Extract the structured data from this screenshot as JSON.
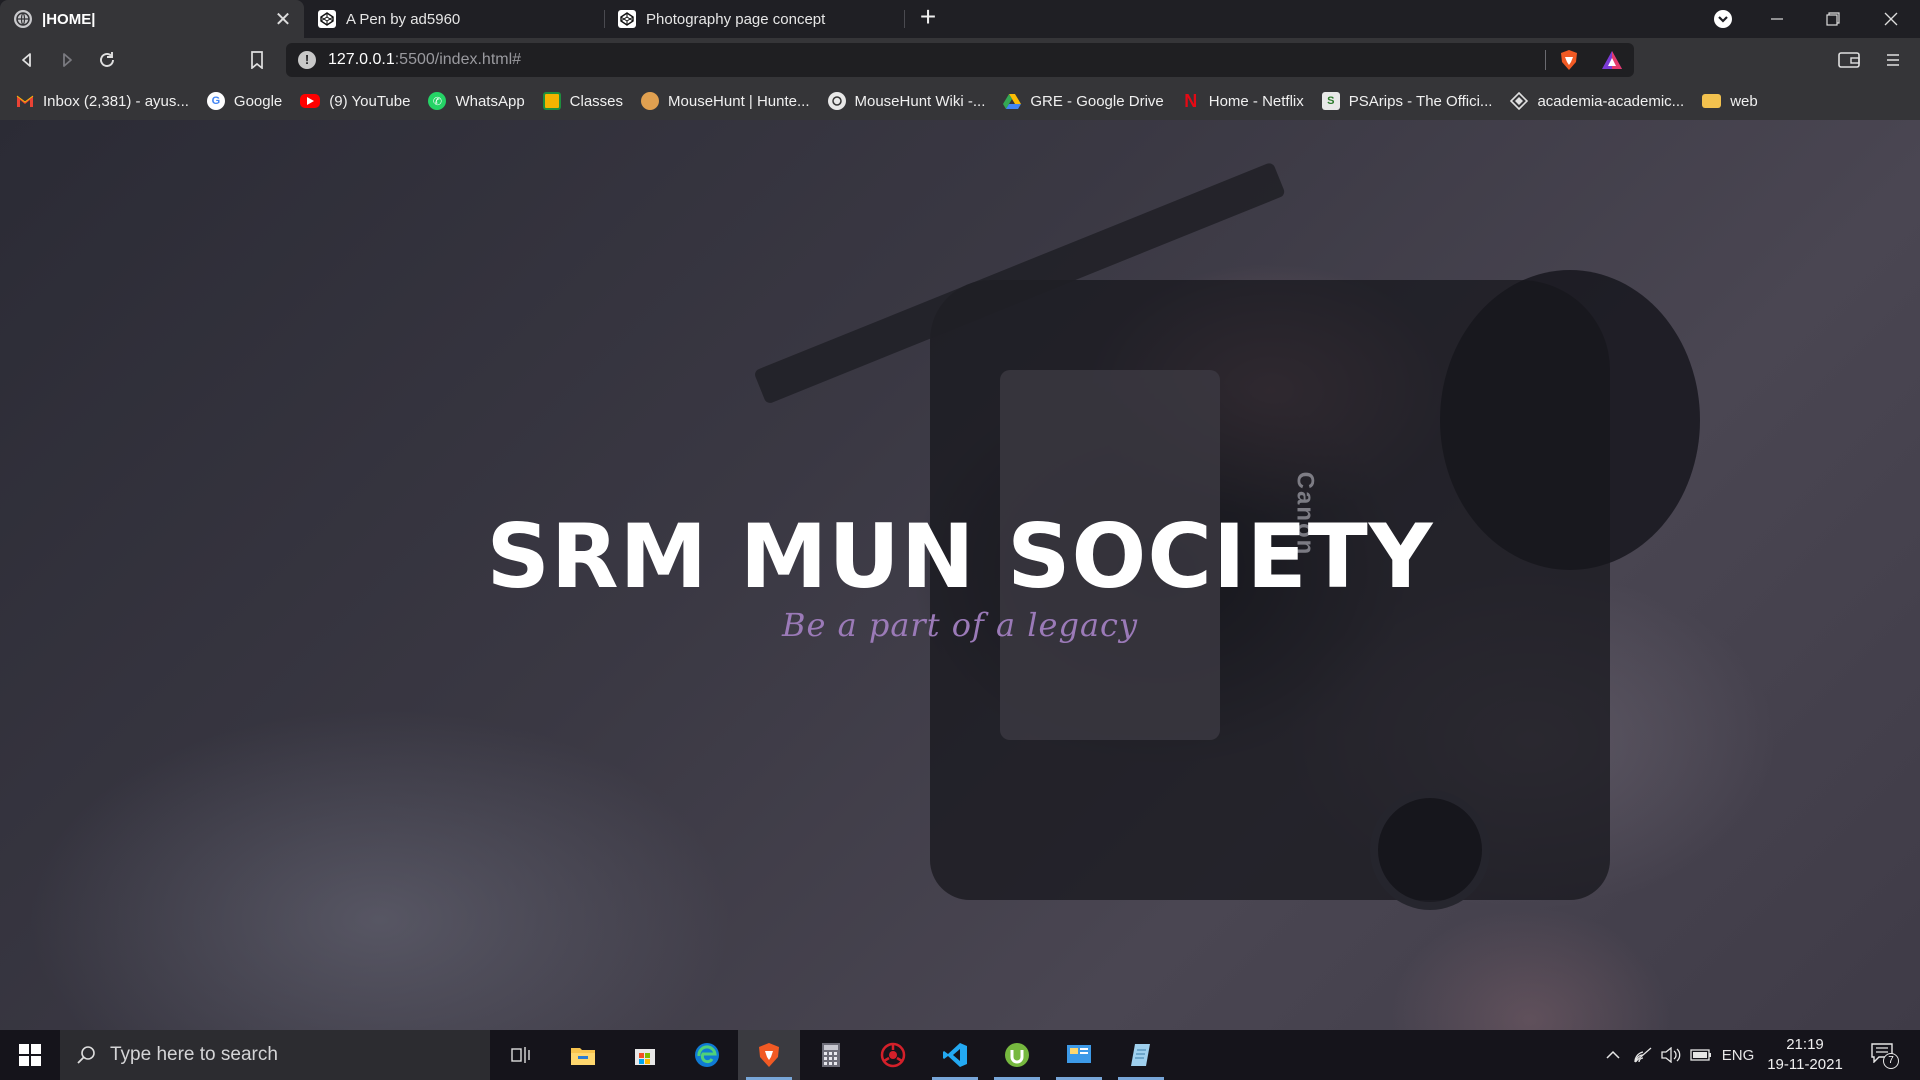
{
  "tabs": [
    {
      "label": "|HOME|",
      "icon": "globe-icon",
      "active": true
    },
    {
      "label": "A Pen by ad5960",
      "icon": "codepen-icon",
      "active": false
    },
    {
      "label": "Photography page concept",
      "icon": "codepen-icon",
      "active": false
    }
  ],
  "address": {
    "host": "127.0.0.1",
    "path": ":5500/index.html#"
  },
  "bookmarks": [
    {
      "label": "Inbox (2,381) - ayus...",
      "icon": "gmail-icon"
    },
    {
      "label": "Google",
      "icon": "google-icon"
    },
    {
      "label": "(9) YouTube",
      "icon": "youtube-icon"
    },
    {
      "label": "WhatsApp",
      "icon": "whatsapp-icon"
    },
    {
      "label": "Classes",
      "icon": "classroom-icon"
    },
    {
      "label": "MouseHunt | Hunte...",
      "icon": "mousehunt-icon"
    },
    {
      "label": "MouseHunt Wiki -...",
      "icon": "wiki-icon"
    },
    {
      "label": "GRE - Google Drive",
      "icon": "drive-icon"
    },
    {
      "label": "Home - Netflix",
      "icon": "netflix-icon"
    },
    {
      "label": "PSArips - The Offici...",
      "icon": "psarips-icon"
    },
    {
      "label": "academia-academic...",
      "icon": "academia-icon"
    },
    {
      "label": "web",
      "icon": "folder-icon"
    }
  ],
  "hero": {
    "title": "SRM MUN SOCIETY",
    "tagline": "Be a part of a legacy",
    "camera_brand": "Canon"
  },
  "taskbar": {
    "search_placeholder": "Type here to search",
    "apps": [
      "task-view",
      "file-explorer",
      "microsoft-store",
      "edge",
      "brave",
      "calculator",
      "app-red",
      "vscode",
      "utorrent",
      "control-panel",
      "notepad"
    ],
    "language": "ENG",
    "time": "21:19",
    "date": "19-11-2021",
    "notifications": "7"
  },
  "colors": {
    "tagline": "#9b7ab8",
    "tab_bar": "#1f1f24",
    "toolbar": "#353538",
    "taskbar": "#15141b"
  }
}
